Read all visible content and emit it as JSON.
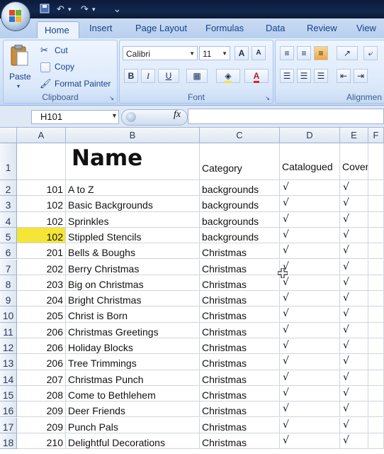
{
  "quick_access": {
    "undo": "↶",
    "redo": "↷",
    "more": "⌄"
  },
  "tabs": [
    "Home",
    "Insert",
    "Page Layout",
    "Formulas",
    "Data",
    "Review",
    "View"
  ],
  "clipboard": {
    "paste_label": "Paste",
    "cut_label": "Cut",
    "copy_label": "Copy",
    "format_painter_label": "Format Painter",
    "group_label": "Clipboard"
  },
  "font": {
    "font_name": "Calibri",
    "font_size": "11",
    "grow": "A",
    "shrink": "A",
    "bold": "B",
    "italic": "I",
    "underline": "U",
    "font_color": "A",
    "group_label": "Font"
  },
  "alignment": {
    "group_label": "Alignmen"
  },
  "formula_bar": {
    "name_box": "H101",
    "fx_label": "fx",
    "formula": ""
  },
  "columns": [
    "A",
    "B",
    "C",
    "D",
    "E",
    "F"
  ],
  "header_row": {
    "row": "1",
    "name": "Name",
    "category": "Category",
    "catalogued": "Catalogued",
    "cover": "Cover"
  },
  "check_mark": "√",
  "rows": [
    {
      "row": "2",
      "a": "101",
      "b": "A to Z",
      "c": "backgrounds"
    },
    {
      "row": "3",
      "a": "102",
      "b": "Basic Backgrounds",
      "c": "backgrounds"
    },
    {
      "row": "4",
      "a": "102",
      "b": "Sprinkles",
      "c": "backgrounds"
    },
    {
      "row": "5",
      "a": "102",
      "b": "Stippled Stencils",
      "c": "backgrounds"
    },
    {
      "row": "6",
      "a": "201",
      "b": "Bells & Boughs",
      "c": "Christmas"
    },
    {
      "row": "7",
      "a": "202",
      "b": "Berry Christmas",
      "c": "Christmas"
    },
    {
      "row": "8",
      "a": "203",
      "b": "Big on Christmas",
      "c": "Christmas"
    },
    {
      "row": "9",
      "a": "204",
      "b": "Bright Christmas",
      "c": "Christmas"
    },
    {
      "row": "10",
      "a": "205",
      "b": "Christ is Born",
      "c": "Christmas"
    },
    {
      "row": "11",
      "a": "206",
      "b": "Christmas Greetings",
      "c": "Christmas"
    },
    {
      "row": "12",
      "a": "206",
      "b": "Holiday Blocks",
      "c": "Christmas"
    },
    {
      "row": "13",
      "a": "206",
      "b": "Tree Trimmings",
      "c": "Christmas"
    },
    {
      "row": "14",
      "a": "207",
      "b": "Christmas Punch",
      "c": "Christmas"
    },
    {
      "row": "15",
      "a": "208",
      "b": "Come to Bethlehem",
      "c": "Christmas"
    },
    {
      "row": "16",
      "a": "209",
      "b": "Deer Friends",
      "c": "Christmas"
    },
    {
      "row": "17",
      "a": "209",
      "b": "Punch Pals",
      "c": "Christmas"
    },
    {
      "row": "18",
      "a": "210",
      "b": "Delightful Decorations",
      "c": "Christmas"
    }
  ],
  "highlighted_row": "5",
  "highlight_color": "#f5e537"
}
